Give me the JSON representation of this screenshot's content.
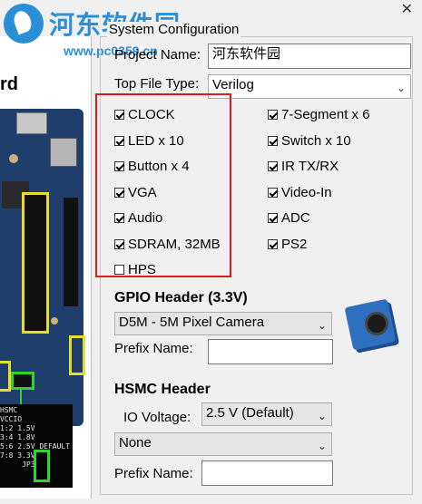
{
  "board": {
    "title": "rd"
  },
  "watermark": {
    "text": "河东软件园",
    "url": "www.pc0359.cn"
  },
  "window": {
    "close_glyph": "✕"
  },
  "system_config": {
    "legend": "System Configuration",
    "project_name_label": "Project Name:",
    "project_name_value": "河东软件园",
    "top_file_type_label": "Top File Type:",
    "top_file_type_value": "Verilog"
  },
  "components_left": [
    {
      "label": "CLOCK",
      "checked": true
    },
    {
      "label": "LED x 10",
      "checked": true
    },
    {
      "label": "Button x 4",
      "checked": true
    },
    {
      "label": "VGA",
      "checked": true
    },
    {
      "label": "Audio",
      "checked": true
    },
    {
      "label": "SDRAM, 32MB",
      "checked": true
    },
    {
      "label": "HPS",
      "checked": false
    }
  ],
  "components_right": [
    {
      "label": "7-Segment x 6",
      "checked": true
    },
    {
      "label": "Switch x 10",
      "checked": true
    },
    {
      "label": "IR TX/RX",
      "checked": true
    },
    {
      "label": "Video-In",
      "checked": true
    },
    {
      "label": "ADC",
      "checked": true
    },
    {
      "label": "PS2",
      "checked": true
    }
  ],
  "gpio": {
    "title": "GPIO Header (3.3V)",
    "device": "D5M - 5M Pixel Camera",
    "prefix_label": "Prefix Name:",
    "prefix_value": ""
  },
  "hsmc": {
    "title": "HSMC Header",
    "io_voltage_label": "IO Voltage:",
    "io_voltage_value": "2.5 V (Default)",
    "device": "None",
    "prefix_label": "Prefix Name:",
    "prefix_value": ""
  },
  "pin_panel_text": "HSMC\nVCCIO\n1:2 1.5V\n3:4 1.8V\n5:6 2.5V DEFAULT\n7:8 3.3V\n     JP3",
  "colors": {
    "highlight_red": "#e21a1a",
    "highlight_yellow": "#e8de2a",
    "highlight_green": "#2fd52f",
    "watermark_blue": "#2b8fd6"
  }
}
